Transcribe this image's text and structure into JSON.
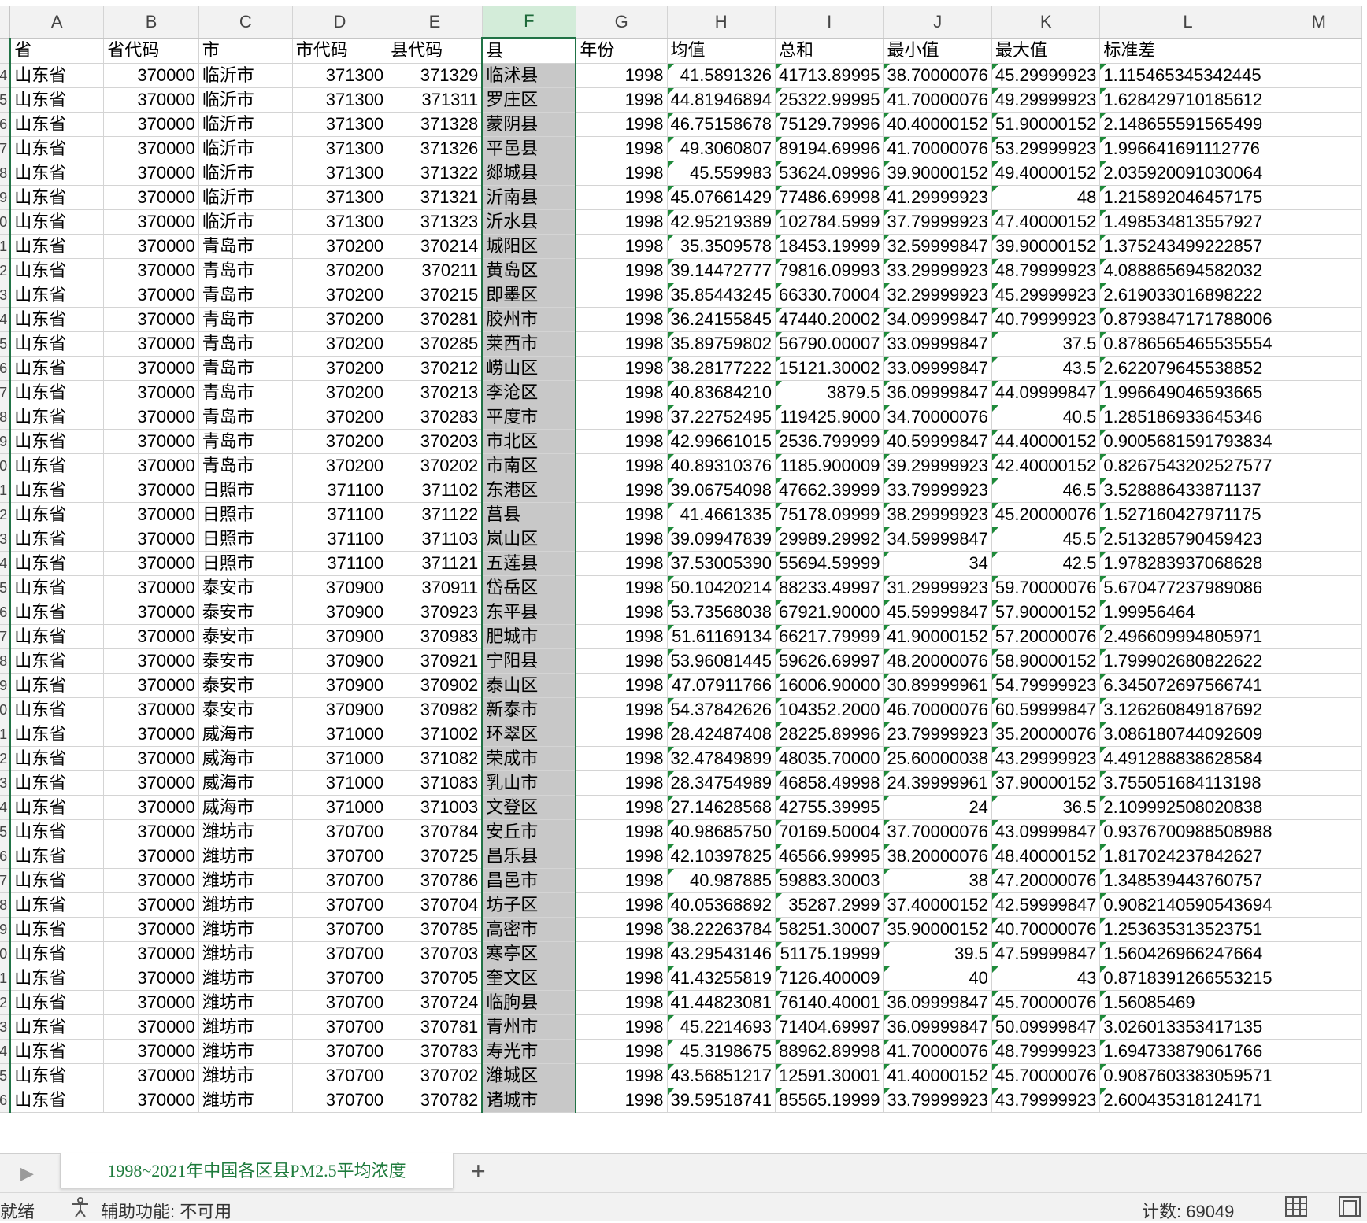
{
  "sheet": {
    "columns": [
      "A",
      "B",
      "C",
      "D",
      "E",
      "F",
      "G",
      "H",
      "I",
      "J",
      "K",
      "L",
      "M"
    ],
    "headers": [
      "省",
      "省代码",
      "市",
      "市代码",
      "县代码",
      "县",
      "年份",
      "均值",
      "总和",
      "最小值",
      "最大值",
      "标准差"
    ],
    "row_numbers_partial": [
      "4",
      "5",
      "6",
      "7",
      "8",
      "9",
      "0",
      "1",
      "2",
      "3",
      "4",
      "5",
      "6",
      "7",
      "8",
      "9",
      "0",
      "1",
      "2",
      "3",
      "4",
      "5",
      "6",
      "7",
      "8",
      "9",
      "0",
      "1",
      "2",
      "3",
      "4",
      "5",
      "6",
      "7",
      "8",
      "9",
      "0",
      "1",
      "2",
      "3",
      "4",
      "5",
      "6"
    ],
    "rows": [
      [
        "山东省",
        "370000",
        "临沂市",
        "371300",
        "371329",
        "临沭县",
        "1998",
        "41.5891326",
        "41713.89995",
        "38.70000076",
        "45.29999923",
        "1.115465345342445"
      ],
      [
        "山东省",
        "370000",
        "临沂市",
        "371300",
        "371311",
        "罗庄区",
        "1998",
        "44.81946894",
        "25322.99995",
        "41.70000076",
        "49.29999923",
        "1.628429710185612"
      ],
      [
        "山东省",
        "370000",
        "临沂市",
        "371300",
        "371328",
        "蒙阴县",
        "1998",
        "46.75158678",
        "75129.79996",
        "40.40000152",
        "51.90000152",
        "2.148655591565499"
      ],
      [
        "山东省",
        "370000",
        "临沂市",
        "371300",
        "371326",
        "平邑县",
        "1998",
        "49.3060807",
        "89194.69996",
        "41.70000076",
        "53.29999923",
        "1.996641691112776"
      ],
      [
        "山东省",
        "370000",
        "临沂市",
        "371300",
        "371322",
        "郯城县",
        "1998",
        "45.559983",
        "53624.09996",
        "39.90000152",
        "49.40000152",
        "2.035920091030064"
      ],
      [
        "山东省",
        "370000",
        "临沂市",
        "371300",
        "371321",
        "沂南县",
        "1998",
        "45.07661429",
        "77486.69998",
        "41.29999923",
        "48",
        "1.215892046457175"
      ],
      [
        "山东省",
        "370000",
        "临沂市",
        "371300",
        "371323",
        "沂水县",
        "1998",
        "42.95219389",
        "102784.5999",
        "37.79999923",
        "47.40000152",
        "1.498534813557927"
      ],
      [
        "山东省",
        "370000",
        "青岛市",
        "370200",
        "370214",
        "城阳区",
        "1998",
        "35.3509578",
        "18453.19999",
        "32.59999847",
        "39.90000152",
        "1.375243499222857"
      ],
      [
        "山东省",
        "370000",
        "青岛市",
        "370200",
        "370211",
        "黄岛区",
        "1998",
        "39.14472777",
        "79816.09993",
        "33.29999923",
        "48.79999923",
        "4.088865694582032"
      ],
      [
        "山东省",
        "370000",
        "青岛市",
        "370200",
        "370215",
        "即墨区",
        "1998",
        "35.85443245",
        "66330.70004",
        "32.29999923",
        "45.29999923",
        "2.619033016898222"
      ],
      [
        "山东省",
        "370000",
        "青岛市",
        "370200",
        "370281",
        "胶州市",
        "1998",
        "36.24155845",
        "47440.20002",
        "34.09999847",
        "40.79999923",
        "0.8793847171788006"
      ],
      [
        "山东省",
        "370000",
        "青岛市",
        "370200",
        "370285",
        "莱西市",
        "1998",
        "35.89759802",
        "56790.00007",
        "33.09999847",
        "37.5",
        "0.8786565465535554"
      ],
      [
        "山东省",
        "370000",
        "青岛市",
        "370200",
        "370212",
        "崂山区",
        "1998",
        "38.28177222",
        "15121.30002",
        "33.09999847",
        "43.5",
        "2.622079645538852"
      ],
      [
        "山东省",
        "370000",
        "青岛市",
        "370200",
        "370213",
        "李沧区",
        "1998",
        "40.83684210",
        "3879.5",
        "36.09999847",
        "44.09999847",
        "1.996649046593665"
      ],
      [
        "山东省",
        "370000",
        "青岛市",
        "370200",
        "370283",
        "平度市",
        "1998",
        "37.22752495",
        "119425.9000",
        "34.70000076",
        "40.5",
        "1.285186933645346"
      ],
      [
        "山东省",
        "370000",
        "青岛市",
        "370200",
        "370203",
        "市北区",
        "1998",
        "42.99661015",
        "2536.799999",
        "40.59999847",
        "44.40000152",
        "0.9005681591793834"
      ],
      [
        "山东省",
        "370000",
        "青岛市",
        "370200",
        "370202",
        "市南区",
        "1998",
        "40.89310376",
        "1185.900009",
        "39.29999923",
        "42.40000152",
        "0.8267543202527577"
      ],
      [
        "山东省",
        "370000",
        "日照市",
        "371100",
        "371102",
        "东港区",
        "1998",
        "39.06754098",
        "47662.39999",
        "33.79999923",
        "46.5",
        "3.528886433871137"
      ],
      [
        "山东省",
        "370000",
        "日照市",
        "371100",
        "371122",
        "莒县",
        "1998",
        "41.4661335",
        "75178.09999",
        "38.29999923",
        "45.20000076",
        "1.527160427971175"
      ],
      [
        "山东省",
        "370000",
        "日照市",
        "371100",
        "371103",
        "岚山区",
        "1998",
        "39.09947839",
        "29989.29992",
        "34.59999847",
        "45.5",
        "2.513285790459423"
      ],
      [
        "山东省",
        "370000",
        "日照市",
        "371100",
        "371121",
        "五莲县",
        "1998",
        "37.53005390",
        "55694.59999",
        "34",
        "42.5",
        "1.978283937068628"
      ],
      [
        "山东省",
        "370000",
        "泰安市",
        "370900",
        "370911",
        "岱岳区",
        "1998",
        "50.10420214",
        "88233.49997",
        "31.29999923",
        "59.70000076",
        "5.670477237989086"
      ],
      [
        "山东省",
        "370000",
        "泰安市",
        "370900",
        "370923",
        "东平县",
        "1998",
        "53.73568038",
        "67921.90000",
        "45.59999847",
        "57.90000152",
        "1.99956464"
      ],
      [
        "山东省",
        "370000",
        "泰安市",
        "370900",
        "370983",
        "肥城市",
        "1998",
        "51.61169134",
        "66217.79999",
        "41.90000152",
        "57.20000076",
        "2.496609994805971"
      ],
      [
        "山东省",
        "370000",
        "泰安市",
        "370900",
        "370921",
        "宁阳县",
        "1998",
        "53.96081445",
        "59626.69997",
        "48.20000076",
        "58.90000152",
        "1.799902680822622"
      ],
      [
        "山东省",
        "370000",
        "泰安市",
        "370900",
        "370902",
        "泰山区",
        "1998",
        "47.07911766",
        "16006.90000",
        "30.89999961",
        "54.79999923",
        "6.345072697566741"
      ],
      [
        "山东省",
        "370000",
        "泰安市",
        "370900",
        "370982",
        "新泰市",
        "1998",
        "54.37842626",
        "104352.2000",
        "46.70000076",
        "60.59999847",
        "3.126260849187692"
      ],
      [
        "山东省",
        "370000",
        "威海市",
        "371000",
        "371002",
        "环翠区",
        "1998",
        "28.42487408",
        "28225.89996",
        "23.79999923",
        "35.20000076",
        "3.086180744092609"
      ],
      [
        "山东省",
        "370000",
        "威海市",
        "371000",
        "371082",
        "荣成市",
        "1998",
        "32.47849899",
        "48035.70000",
        "25.60000038",
        "43.29999923",
        "4.491288838628584"
      ],
      [
        "山东省",
        "370000",
        "威海市",
        "371000",
        "371083",
        "乳山市",
        "1998",
        "28.34754989",
        "46858.49998",
        "24.39999961",
        "37.90000152",
        "3.755051684113198"
      ],
      [
        "山东省",
        "370000",
        "威海市",
        "371000",
        "371003",
        "文登区",
        "1998",
        "27.14628568",
        "42755.39995",
        "24",
        "36.5",
        "2.109992508020838"
      ],
      [
        "山东省",
        "370000",
        "潍坊市",
        "370700",
        "370784",
        "安丘市",
        "1998",
        "40.98685750",
        "70169.50004",
        "37.70000076",
        "43.09999847",
        "0.9376700988508988"
      ],
      [
        "山东省",
        "370000",
        "潍坊市",
        "370700",
        "370725",
        "昌乐县",
        "1998",
        "42.10397825",
        "46566.99995",
        "38.20000076",
        "48.40000152",
        "1.817024237842627"
      ],
      [
        "山东省",
        "370000",
        "潍坊市",
        "370700",
        "370786",
        "昌邑市",
        "1998",
        "40.987885",
        "59883.30003",
        "38",
        "47.20000076",
        "1.348539443760757"
      ],
      [
        "山东省",
        "370000",
        "潍坊市",
        "370700",
        "370704",
        "坊子区",
        "1998",
        "40.05368892",
        "35287.2999",
        "37.40000152",
        "42.59999847",
        "0.9082140590543694"
      ],
      [
        "山东省",
        "370000",
        "潍坊市",
        "370700",
        "370785",
        "高密市",
        "1998",
        "38.22263784",
        "58251.30007",
        "35.90000152",
        "40.70000076",
        "1.253635313523751"
      ],
      [
        "山东省",
        "370000",
        "潍坊市",
        "370700",
        "370703",
        "寒亭区",
        "1998",
        "43.29543146",
        "51175.19999",
        "39.5",
        "47.59999847",
        "1.560426966247664"
      ],
      [
        "山东省",
        "370000",
        "潍坊市",
        "370700",
        "370705",
        "奎文区",
        "1998",
        "41.43255819",
        "7126.400009",
        "40",
        "43",
        "0.8718391266553215"
      ],
      [
        "山东省",
        "370000",
        "潍坊市",
        "370700",
        "370724",
        "临朐县",
        "1998",
        "41.44823081",
        "76140.40001",
        "36.09999847",
        "45.70000076",
        "1.56085469"
      ],
      [
        "山东省",
        "370000",
        "潍坊市",
        "370700",
        "370781",
        "青州市",
        "1998",
        "45.2214693",
        "71404.69997",
        "36.09999847",
        "50.09999847",
        "3.026013353417135"
      ],
      [
        "山东省",
        "370000",
        "潍坊市",
        "370700",
        "370783",
        "寿光市",
        "1998",
        "45.3198675",
        "88962.89998",
        "41.70000076",
        "48.79999923",
        "1.694733879061766"
      ],
      [
        "山东省",
        "370000",
        "潍坊市",
        "370700",
        "370702",
        "潍城区",
        "1998",
        "43.56851217",
        "12591.30001",
        "41.40000152",
        "45.70000076",
        "0.9087603383059571"
      ],
      [
        "山东省",
        "370000",
        "潍坊市",
        "370700",
        "370782",
        "诸城市",
        "1998",
        "39.59518741",
        "85565.19999",
        "33.79999923",
        "43.79999923",
        "2.600435318124171"
      ]
    ]
  },
  "tabs": {
    "nav_icon": "play-right-icon",
    "sheet_name": "1998~2021年中国各区县PM2.5平均浓度",
    "add_label": "+"
  },
  "status": {
    "ready": "就绪",
    "accessibility": "辅助功能: 不可用",
    "count": "计数: 69049"
  },
  "colors": {
    "accent": "#217346",
    "selected_column": "#c8c8c8",
    "tab_text": "#1e7b3c"
  }
}
